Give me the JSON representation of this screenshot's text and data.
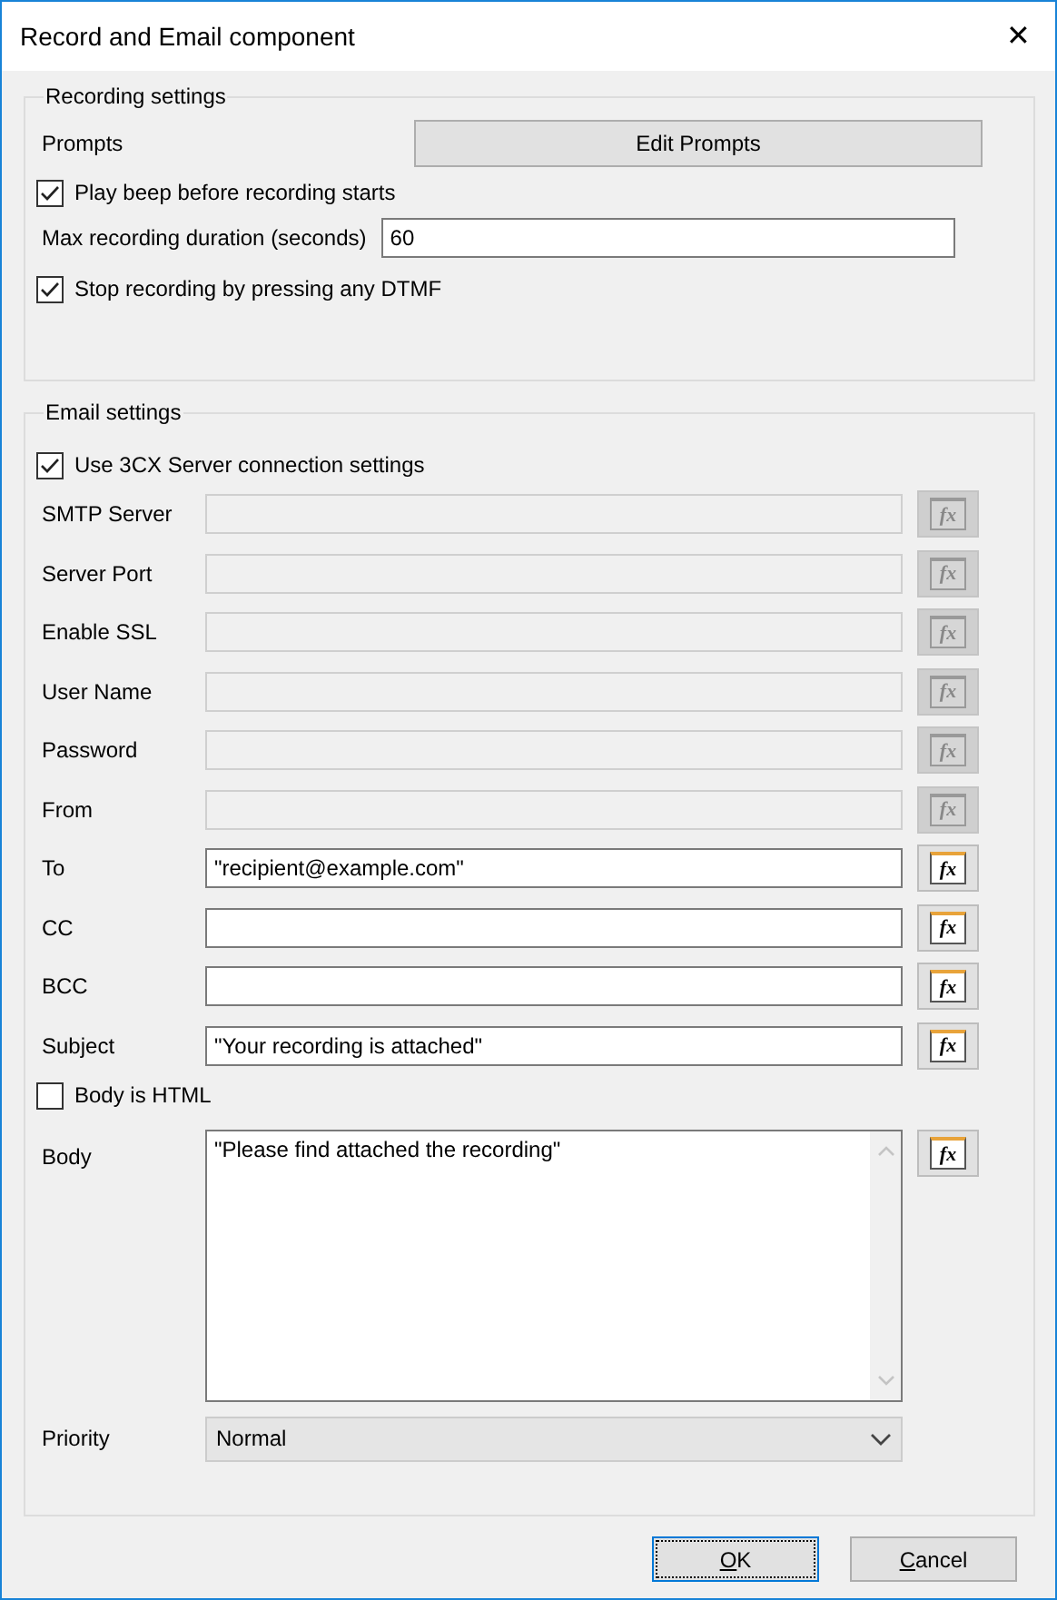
{
  "window": {
    "title": "Record and Email component",
    "close": "✕"
  },
  "recording": {
    "title": "Recording settings",
    "prompts_label": "Prompts",
    "edit_button": "Edit Prompts",
    "play_beep": {
      "label": "Play beep before recording starts",
      "checked": true
    },
    "duration": {
      "label": "Max recording duration (seconds)",
      "value": "60"
    },
    "stop_dtmf": {
      "label": "Stop recording by pressing any DTMF",
      "checked": true
    }
  },
  "email": {
    "title": "Email settings",
    "use_server": {
      "label": "Use 3CX Server connection settings",
      "checked": true
    },
    "fields": [
      {
        "label": "SMTP Server",
        "disabled": true,
        "fx": "fx"
      },
      {
        "label": "Server Port",
        "disabled": true,
        "fx": "fx"
      },
      {
        "label": "Enable SSL",
        "disabled": true,
        "fx": "fx"
      },
      {
        "label": "User Name",
        "disabled": true,
        "fx": "fx"
      },
      {
        "label": "Password",
        "disabled": true,
        "fx": "fx"
      },
      {
        "label": "From",
        "disabled": true,
        "fx": "fx"
      },
      {
        "label": "To",
        "value": "\"recipient@example.com\"",
        "disabled": false,
        "fx": "fx"
      },
      {
        "label": "CC",
        "disabled": false,
        "fx": "fx"
      },
      {
        "label": "BCC",
        "disabled": false,
        "fx": "fx"
      },
      {
        "label": "Subject",
        "value": "\"Your recording is attached\"",
        "disabled": false,
        "fx": "fx"
      }
    ],
    "body_html": {
      "label": "Body is HTML",
      "checked": false
    },
    "body": {
      "label": "Body",
      "value": "\"Please find attached the recording\"",
      "fx": "fx"
    },
    "priority": {
      "label": "Priority",
      "value": "Normal"
    }
  },
  "buttons": [
    {
      "accel": "O",
      "rest": "K",
      "default": true
    },
    {
      "accel": "C",
      "rest": "ancel",
      "default": false
    }
  ]
}
